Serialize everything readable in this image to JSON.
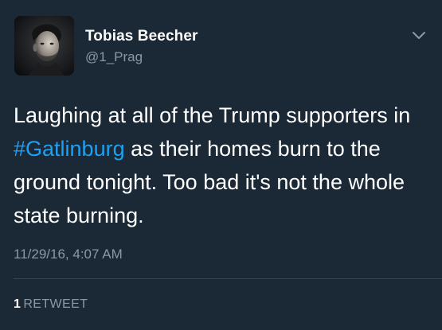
{
  "tweet": {
    "author": {
      "display_name": "Tobias Beecher",
      "handle": "@1_Prag"
    },
    "text": {
      "before_hashtag": "Laughing at all of the Trump supporters in ",
      "hashtag": "#Gatlinburg",
      "after_hashtag": " as their homes burn to the ground tonight. Too bad it's not the whole state burning."
    },
    "timestamp": "11/29/16, 4:07 AM",
    "stats": {
      "retweet_count": "1",
      "retweet_label": "RETWEET"
    },
    "menu_icon": "chevron-down-icon"
  },
  "colors": {
    "background": "#1b2836",
    "text_primary": "#ffffff",
    "text_secondary": "#8899a6",
    "link": "#1da1f2",
    "divider": "#38444d"
  }
}
